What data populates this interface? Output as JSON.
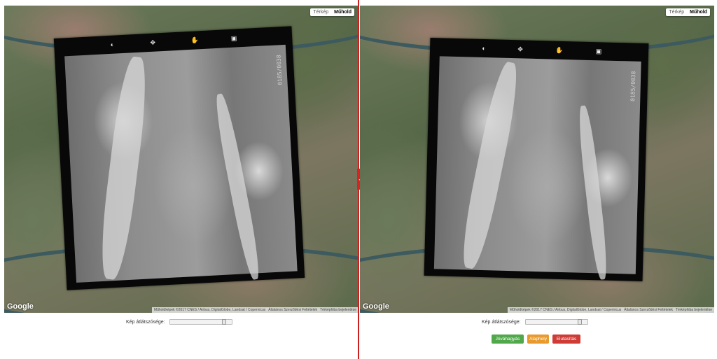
{
  "map_type": {
    "map_label": "Térkép",
    "satellite_label": "Műhold",
    "active": "satellite"
  },
  "google_logo": "Google",
  "attribution": {
    "imagery": "Műholdképek ©2017 CNES / Airbus, DigitalGlobe, Landsat / Copernicus",
    "terms": "Általános Szerződési Feltételek",
    "report": "Térképhiba bejelentése"
  },
  "photo": {
    "frame_label": "0185/0038"
  },
  "opacity": {
    "label": "Kép átlátszósége:",
    "left_value": 0.9,
    "right_value": 0.9
  },
  "buttons": {
    "approve": "Jóváhagyás",
    "reset": "Alaphely",
    "discard": "Elutasítás"
  },
  "colors": {
    "divider": "#cc2020",
    "approve": "#4fa84a",
    "reset": "#e89a2c",
    "discard": "#cf3b35"
  }
}
